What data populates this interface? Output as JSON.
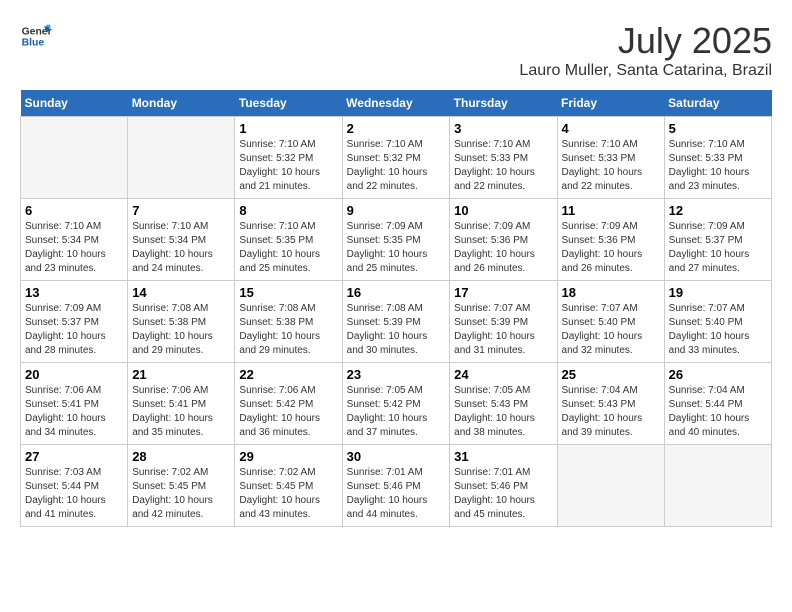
{
  "header": {
    "logo_line1": "General",
    "logo_line2": "Blue",
    "month": "July 2025",
    "location": "Lauro Muller, Santa Catarina, Brazil"
  },
  "weekdays": [
    "Sunday",
    "Monday",
    "Tuesday",
    "Wednesday",
    "Thursday",
    "Friday",
    "Saturday"
  ],
  "weeks": [
    [
      {
        "day": "",
        "info": ""
      },
      {
        "day": "",
        "info": ""
      },
      {
        "day": "1",
        "info": "Sunrise: 7:10 AM\nSunset: 5:32 PM\nDaylight: 10 hours\nand 21 minutes."
      },
      {
        "day": "2",
        "info": "Sunrise: 7:10 AM\nSunset: 5:32 PM\nDaylight: 10 hours\nand 22 minutes."
      },
      {
        "day": "3",
        "info": "Sunrise: 7:10 AM\nSunset: 5:33 PM\nDaylight: 10 hours\nand 22 minutes."
      },
      {
        "day": "4",
        "info": "Sunrise: 7:10 AM\nSunset: 5:33 PM\nDaylight: 10 hours\nand 22 minutes."
      },
      {
        "day": "5",
        "info": "Sunrise: 7:10 AM\nSunset: 5:33 PM\nDaylight: 10 hours\nand 23 minutes."
      }
    ],
    [
      {
        "day": "6",
        "info": "Sunrise: 7:10 AM\nSunset: 5:34 PM\nDaylight: 10 hours\nand 23 minutes."
      },
      {
        "day": "7",
        "info": "Sunrise: 7:10 AM\nSunset: 5:34 PM\nDaylight: 10 hours\nand 24 minutes."
      },
      {
        "day": "8",
        "info": "Sunrise: 7:10 AM\nSunset: 5:35 PM\nDaylight: 10 hours\nand 25 minutes."
      },
      {
        "day": "9",
        "info": "Sunrise: 7:09 AM\nSunset: 5:35 PM\nDaylight: 10 hours\nand 25 minutes."
      },
      {
        "day": "10",
        "info": "Sunrise: 7:09 AM\nSunset: 5:36 PM\nDaylight: 10 hours\nand 26 minutes."
      },
      {
        "day": "11",
        "info": "Sunrise: 7:09 AM\nSunset: 5:36 PM\nDaylight: 10 hours\nand 26 minutes."
      },
      {
        "day": "12",
        "info": "Sunrise: 7:09 AM\nSunset: 5:37 PM\nDaylight: 10 hours\nand 27 minutes."
      }
    ],
    [
      {
        "day": "13",
        "info": "Sunrise: 7:09 AM\nSunset: 5:37 PM\nDaylight: 10 hours\nand 28 minutes."
      },
      {
        "day": "14",
        "info": "Sunrise: 7:08 AM\nSunset: 5:38 PM\nDaylight: 10 hours\nand 29 minutes."
      },
      {
        "day": "15",
        "info": "Sunrise: 7:08 AM\nSunset: 5:38 PM\nDaylight: 10 hours\nand 29 minutes."
      },
      {
        "day": "16",
        "info": "Sunrise: 7:08 AM\nSunset: 5:39 PM\nDaylight: 10 hours\nand 30 minutes."
      },
      {
        "day": "17",
        "info": "Sunrise: 7:07 AM\nSunset: 5:39 PM\nDaylight: 10 hours\nand 31 minutes."
      },
      {
        "day": "18",
        "info": "Sunrise: 7:07 AM\nSunset: 5:40 PM\nDaylight: 10 hours\nand 32 minutes."
      },
      {
        "day": "19",
        "info": "Sunrise: 7:07 AM\nSunset: 5:40 PM\nDaylight: 10 hours\nand 33 minutes."
      }
    ],
    [
      {
        "day": "20",
        "info": "Sunrise: 7:06 AM\nSunset: 5:41 PM\nDaylight: 10 hours\nand 34 minutes."
      },
      {
        "day": "21",
        "info": "Sunrise: 7:06 AM\nSunset: 5:41 PM\nDaylight: 10 hours\nand 35 minutes."
      },
      {
        "day": "22",
        "info": "Sunrise: 7:06 AM\nSunset: 5:42 PM\nDaylight: 10 hours\nand 36 minutes."
      },
      {
        "day": "23",
        "info": "Sunrise: 7:05 AM\nSunset: 5:42 PM\nDaylight: 10 hours\nand 37 minutes."
      },
      {
        "day": "24",
        "info": "Sunrise: 7:05 AM\nSunset: 5:43 PM\nDaylight: 10 hours\nand 38 minutes."
      },
      {
        "day": "25",
        "info": "Sunrise: 7:04 AM\nSunset: 5:43 PM\nDaylight: 10 hours\nand 39 minutes."
      },
      {
        "day": "26",
        "info": "Sunrise: 7:04 AM\nSunset: 5:44 PM\nDaylight: 10 hours\nand 40 minutes."
      }
    ],
    [
      {
        "day": "27",
        "info": "Sunrise: 7:03 AM\nSunset: 5:44 PM\nDaylight: 10 hours\nand 41 minutes."
      },
      {
        "day": "28",
        "info": "Sunrise: 7:02 AM\nSunset: 5:45 PM\nDaylight: 10 hours\nand 42 minutes."
      },
      {
        "day": "29",
        "info": "Sunrise: 7:02 AM\nSunset: 5:45 PM\nDaylight: 10 hours\nand 43 minutes."
      },
      {
        "day": "30",
        "info": "Sunrise: 7:01 AM\nSunset: 5:46 PM\nDaylight: 10 hours\nand 44 minutes."
      },
      {
        "day": "31",
        "info": "Sunrise: 7:01 AM\nSunset: 5:46 PM\nDaylight: 10 hours\nand 45 minutes."
      },
      {
        "day": "",
        "info": ""
      },
      {
        "day": "",
        "info": ""
      }
    ]
  ]
}
